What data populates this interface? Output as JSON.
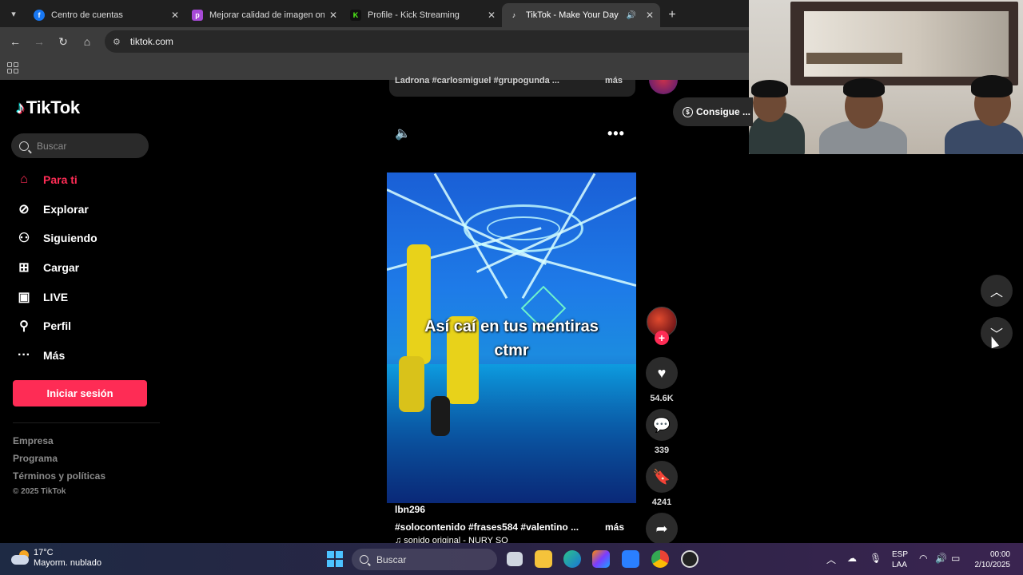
{
  "browser": {
    "tabs": [
      {
        "title": "Centro de cuentas",
        "favicon": "facebook-icon",
        "color": "#1877f2"
      },
      {
        "title": "Mejorar calidad de imagen onli",
        "favicon": "picsart-icon",
        "color": "#a64ad6"
      },
      {
        "title": "Profile - Kick Streaming",
        "favicon": "kick-icon",
        "color": "#53fc18"
      },
      {
        "title": "TikTok - Make Your Day",
        "favicon": "tiktok-icon",
        "color": "#000000"
      }
    ],
    "url": "tiktok.com"
  },
  "tiktok": {
    "logo_text": "TikTok",
    "search_placeholder": "Buscar",
    "nav": [
      {
        "label": "Para ti",
        "icon": "home-icon",
        "active": true
      },
      {
        "label": "Explorar",
        "icon": "compass-icon",
        "active": false
      },
      {
        "label": "Siguiendo",
        "icon": "following-icon",
        "active": false
      },
      {
        "label": "Cargar",
        "icon": "upload-icon",
        "active": false
      },
      {
        "label": "LIVE",
        "icon": "live-icon",
        "active": false
      },
      {
        "label": "Perfil",
        "icon": "profile-icon",
        "active": false
      },
      {
        "label": "Más",
        "icon": "more-icon",
        "active": false
      }
    ],
    "login_label": "Iniciar sesión",
    "footer_links": [
      "Empresa",
      "Programa",
      "Términos y políticas"
    ],
    "copyright": "© 2025 TikTok",
    "accent": "#fe2c55"
  },
  "previous_video": {
    "desc": "Ladrona #carlosmiguel #grupogunda ...",
    "mas": "más",
    "consigue_label": "Consigue ..."
  },
  "video": {
    "caption_line1": "Así caí en tus mentiras",
    "caption_line2": "ctmr",
    "author": "lbn296",
    "hashtags": "#solocontenido   #frases584  #valentino  ...",
    "mas": "más",
    "sound": "♫  sonido original - NURY SO"
  },
  "actions": {
    "likes": "54.6K",
    "comments": "339",
    "saves": "4241"
  },
  "taskbar": {
    "weather_temp": "17°C",
    "weather_desc": "Mayorm. nublado",
    "search_label": "Buscar",
    "lang_line1": "ESP",
    "lang_line2": "LAA",
    "time": "00:00",
    "date": "2/10/2025"
  }
}
